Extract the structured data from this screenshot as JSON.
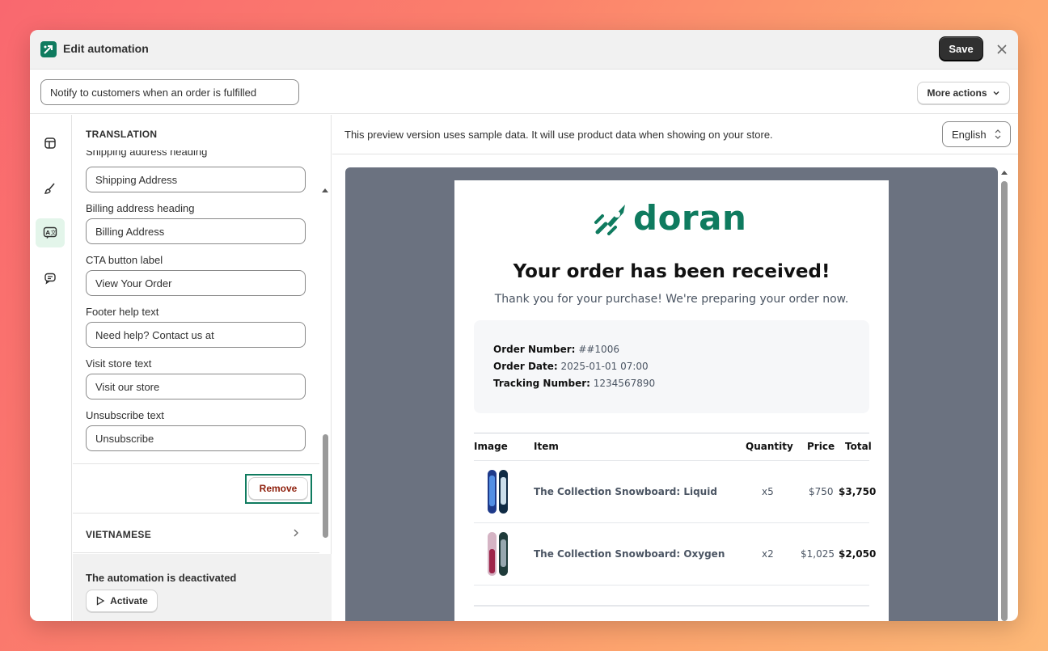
{
  "window": {
    "title": "Edit automation",
    "save_label": "Save"
  },
  "automation": {
    "name": "Notify to customers when an order is fulfilled",
    "more_actions_label": "More actions"
  },
  "rail": {
    "items": [
      "layout-icon",
      "brush-icon",
      "translate-icon",
      "chat-icon"
    ],
    "active_index": 2,
    "active_color": "#e3f5ea"
  },
  "translation": {
    "header": "TRANSLATION",
    "cut_off_label": "Shipping address heading",
    "fields": [
      {
        "label": "",
        "value": "Shipping Address"
      },
      {
        "label": "Billing address heading",
        "value": "Billing Address"
      },
      {
        "label": "CTA button label",
        "value": "View Your Order"
      },
      {
        "label": "Footer help text",
        "value": "Need help? Contact us at"
      },
      {
        "label": "Visit store text",
        "value": "Visit our store"
      },
      {
        "label": "Unsubscribe text",
        "value": "Unsubscribe"
      }
    ],
    "remove_label": "Remove",
    "next_language": "VIETNAMESE"
  },
  "status": {
    "text": "The automation is deactivated",
    "activate_label": "Activate"
  },
  "preview": {
    "note": "This preview version uses sample data. It will use product data when showing on your store.",
    "language": "English"
  },
  "email": {
    "brand": "doran",
    "brand_color": "#0f7b5f",
    "heading": "Your order has been received!",
    "subheading": "Thank you for your purchase! We're preparing your order now.",
    "order": {
      "number_label": "Order Number:",
      "number": "##1006",
      "date_label": "Order Date:",
      "date": "2025-01-01 07:00",
      "tracking_label": "Tracking Number:",
      "tracking": "1234567890"
    },
    "columns": [
      "Image",
      "Item",
      "Quantity",
      "Price",
      "Total"
    ],
    "items": [
      {
        "name": "The Collection Snowboard: Liquid",
        "qty": "x5",
        "price": "$750",
        "total": "$3,750"
      },
      {
        "name": "The Collection Snowboard: Oxygen",
        "qty": "x2",
        "price": "$1,025",
        "total": "$2,050"
      }
    ]
  }
}
